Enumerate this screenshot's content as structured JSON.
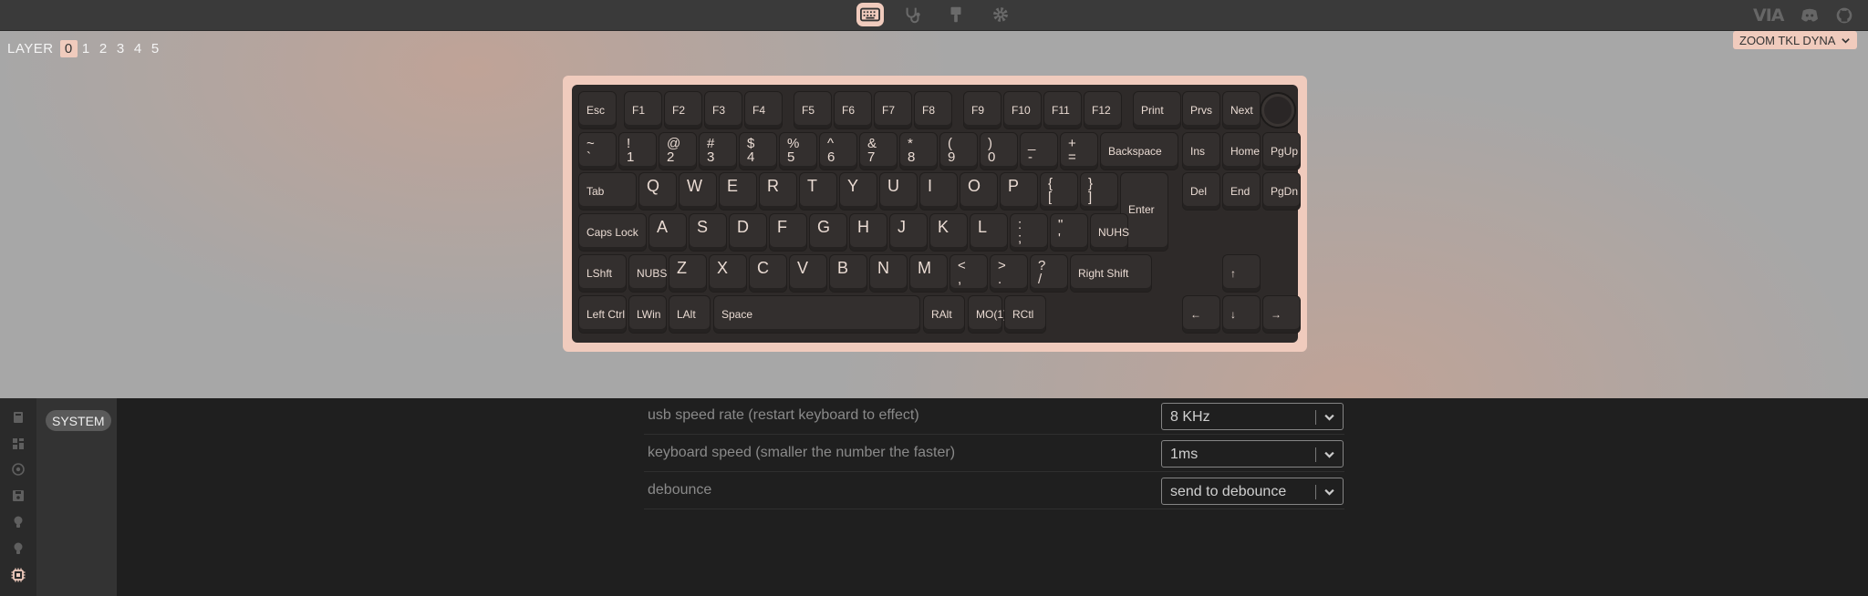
{
  "header": {
    "nav": [
      {
        "name": "keyboard",
        "icon": "keyboard-icon",
        "active": true
      },
      {
        "name": "test",
        "icon": "stethoscope-icon",
        "active": false
      },
      {
        "name": "design",
        "icon": "paintbrush-icon",
        "active": false
      },
      {
        "name": "settings",
        "icon": "gear-icon",
        "active": false
      }
    ],
    "brand": "VIA",
    "links": [
      "discord-icon",
      "github-icon"
    ]
  },
  "layers": {
    "label": "LAYER",
    "items": [
      "0",
      "1",
      "2",
      "3",
      "4",
      "5"
    ],
    "active": "0"
  },
  "device": {
    "name": "ZOOM TKL DYNA"
  },
  "keyboard": {
    "rows": [
      [
        {
          "k": "esc",
          "l": "Esc"
        },
        {
          "k": "f1",
          "l": "F1"
        },
        {
          "k": "f2",
          "l": "F2"
        },
        {
          "k": "f3",
          "l": "F3"
        },
        {
          "k": "f4",
          "l": "F4"
        },
        {
          "k": "f5",
          "l": "F5"
        },
        {
          "k": "f6",
          "l": "F6"
        },
        {
          "k": "f7",
          "l": "F7"
        },
        {
          "k": "f8",
          "l": "F8"
        },
        {
          "k": "f9",
          "l": "F9"
        },
        {
          "k": "f10",
          "l": "F10"
        },
        {
          "k": "f11",
          "l": "F11"
        },
        {
          "k": "f12",
          "l": "F12"
        },
        {
          "k": "print",
          "l": "Print"
        },
        {
          "k": "prvs",
          "l": "Prvs"
        },
        {
          "k": "next",
          "l": "Next"
        },
        {
          "k": "knob",
          "l": ""
        }
      ],
      [
        {
          "k": "grave",
          "t": "~",
          "b": "`"
        },
        {
          "k": "1",
          "t": "!",
          "b": "1"
        },
        {
          "k": "2",
          "t": "@",
          "b": "2"
        },
        {
          "k": "3",
          "t": "#",
          "b": "3"
        },
        {
          "k": "4",
          "t": "$",
          "b": "4"
        },
        {
          "k": "5",
          "t": "%",
          "b": "5"
        },
        {
          "k": "6",
          "t": "^",
          "b": "6"
        },
        {
          "k": "7",
          "t": "&",
          "b": "7"
        },
        {
          "k": "8",
          "t": "*",
          "b": "8"
        },
        {
          "k": "9",
          "t": "(",
          "b": "9"
        },
        {
          "k": "0",
          "t": ")",
          "b": "0"
        },
        {
          "k": "minus",
          "t": "_",
          "b": "-"
        },
        {
          "k": "equal",
          "t": "+",
          "b": "="
        },
        {
          "k": "backspace",
          "l": "Backspace"
        },
        {
          "k": "ins",
          "l": "Ins"
        },
        {
          "k": "home",
          "l": "Home"
        },
        {
          "k": "pgup",
          "l": "PgUp"
        }
      ],
      [
        {
          "k": "tab",
          "l": "Tab"
        },
        {
          "k": "q",
          "c": "Q"
        },
        {
          "k": "w",
          "c": "W"
        },
        {
          "k": "e",
          "c": "E"
        },
        {
          "k": "r",
          "c": "R"
        },
        {
          "k": "t",
          "c": "T"
        },
        {
          "k": "y",
          "c": "Y"
        },
        {
          "k": "u",
          "c": "U"
        },
        {
          "k": "i",
          "c": "I"
        },
        {
          "k": "o",
          "c": "O"
        },
        {
          "k": "p",
          "c": "P"
        },
        {
          "k": "lbracket",
          "t": "{",
          "b": "["
        },
        {
          "k": "rbracket",
          "t": "}",
          "b": "]"
        },
        {
          "k": "enter",
          "l": "Enter"
        },
        {
          "k": "del",
          "l": "Del"
        },
        {
          "k": "end",
          "l": "End"
        },
        {
          "k": "pgdn",
          "l": "PgDn"
        }
      ],
      [
        {
          "k": "caps",
          "l": "Caps Lock"
        },
        {
          "k": "a",
          "c": "A"
        },
        {
          "k": "s",
          "c": "S"
        },
        {
          "k": "d",
          "c": "D"
        },
        {
          "k": "f",
          "c": "F"
        },
        {
          "k": "g",
          "c": "G"
        },
        {
          "k": "h",
          "c": "H"
        },
        {
          "k": "j",
          "c": "J"
        },
        {
          "k": "k",
          "c": "K"
        },
        {
          "k": "l",
          "c": "L"
        },
        {
          "k": "semicolon",
          "t": ":",
          "b": ";"
        },
        {
          "k": "quote",
          "t": "\"",
          "b": "'"
        },
        {
          "k": "nuhs",
          "l": "NUHS"
        }
      ],
      [
        {
          "k": "lshift",
          "l": "LShft"
        },
        {
          "k": "nubs",
          "l": "NUBS"
        },
        {
          "k": "z",
          "c": "Z"
        },
        {
          "k": "x",
          "c": "X"
        },
        {
          "k": "c",
          "c": "C"
        },
        {
          "k": "v",
          "c": "V"
        },
        {
          "k": "b",
          "c": "B"
        },
        {
          "k": "n",
          "c": "N"
        },
        {
          "k": "m",
          "c": "M"
        },
        {
          "k": "comma",
          "t": "<",
          "b": ","
        },
        {
          "k": "period",
          "t": ">",
          "b": "."
        },
        {
          "k": "slash",
          "t": "?",
          "b": "/"
        },
        {
          "k": "rshift",
          "l": "Right Shift"
        },
        {
          "k": "up",
          "l": "↑"
        }
      ],
      [
        {
          "k": "lctrl",
          "l": "Left Ctrl"
        },
        {
          "k": "lwin",
          "l": "LWin"
        },
        {
          "k": "lalt",
          "l": "LAlt"
        },
        {
          "k": "space",
          "l": "Space"
        },
        {
          "k": "ralt",
          "l": "RAlt"
        },
        {
          "k": "mo1",
          "l": "MO(1)"
        },
        {
          "k": "rctrl",
          "l": "RCtl"
        },
        {
          "k": "left",
          "l": "←"
        },
        {
          "k": "down",
          "l": "↓"
        },
        {
          "k": "right",
          "l": "→"
        }
      ]
    ]
  },
  "sidebar": {
    "icons": [
      "book-icon",
      "grid-icon",
      "target-icon",
      "save-icon",
      "bulb-icon",
      "bulb-alt-icon",
      "chip-icon"
    ],
    "active": "chip-icon"
  },
  "menu": {
    "items": [
      "SYSTEM"
    ]
  },
  "settings": [
    {
      "label": "usb speed rate (restart keyboard to effect)",
      "value": "8 KHz"
    },
    {
      "label": "keyboard speed (smaller the number the faster)",
      "value": "1ms"
    },
    {
      "label": "debounce",
      "value": "send to debounce"
    }
  ]
}
